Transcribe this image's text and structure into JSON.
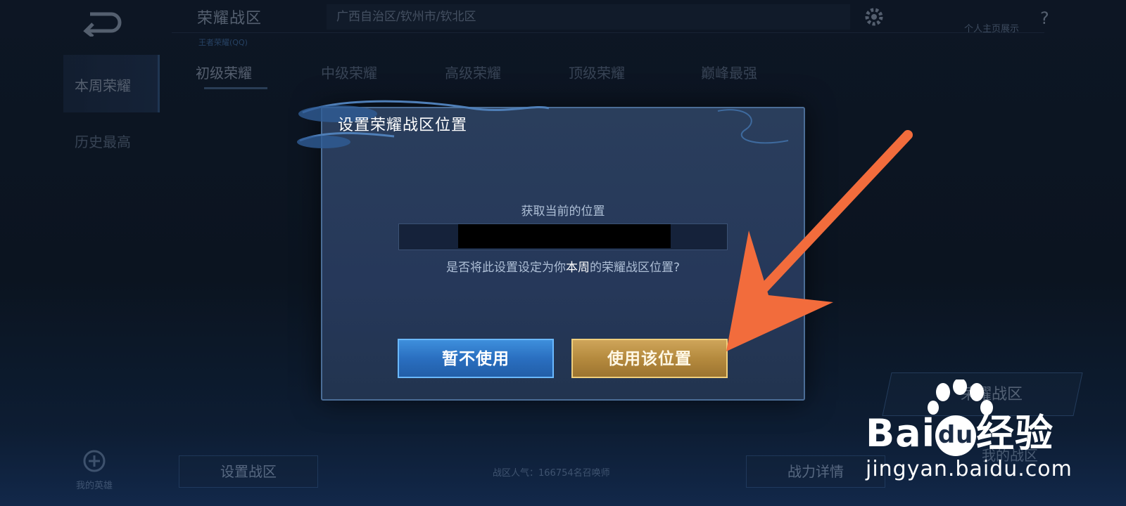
{
  "background": {
    "zone_title": "荣耀战区",
    "zone_subtitle": "王者荣耀(QQ)",
    "location": "广西自治区/钦州市/钦北区",
    "help_text": "个人主页展示",
    "tabs": [
      "初级荣耀",
      "中级荣耀",
      "高级荣耀",
      "顶级荣耀",
      "巅峰最强"
    ],
    "side_items": [
      "本周荣耀",
      "历史最高"
    ],
    "set_zone_button": "设置战区",
    "popularity": "战区人气：166754名召唤师",
    "my_heroes": "我的英雄",
    "power_details_button": "战力详情",
    "glory_card_label": "荣耀战区",
    "my_zone_label": "我的战区"
  },
  "dialog": {
    "title": "设置荣耀战区位置",
    "get_location_label": "获取当前的位置",
    "question_prefix": "是否将此设置设定为你",
    "question_highlight": "本周",
    "question_suffix": "的荣耀战区位置?",
    "cancel_button": "暂不使用",
    "confirm_button": "使用该位置"
  },
  "watermark": {
    "logo_prefix": "Bai",
    "logo_du": "du",
    "logo_suffix": "经验",
    "site": "jingyan.baidu.com"
  },
  "colors": {
    "accent_arrow": "#f26c3c",
    "confirm_gold": "#c89a4b",
    "cancel_blue": "#2f7fd0"
  },
  "icons": [
    "back-arrow-icon",
    "gear-icon",
    "help-icon",
    "crest-icon",
    "paw-icon"
  ]
}
